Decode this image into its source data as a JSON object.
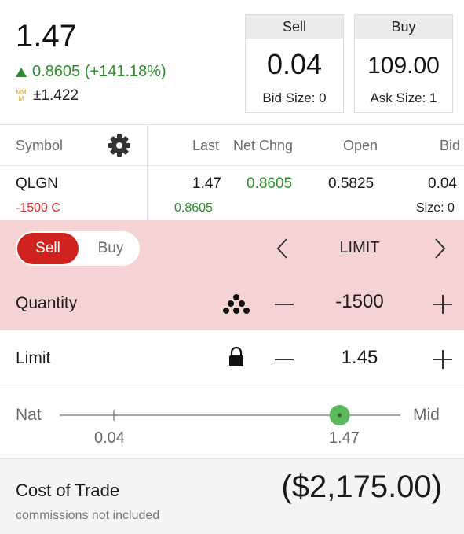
{
  "quote": {
    "last": "1.47",
    "change": "0.8605 (+141.18%)",
    "mm_badge_top": "MM",
    "mm_badge_bottom": "M",
    "mm_value": "±1.422",
    "change_color": "#2e8b2e"
  },
  "sell_box": {
    "header": "Sell",
    "price": "0.04",
    "size_label": "Bid Size: 0"
  },
  "buy_box": {
    "header": "Buy",
    "price": "109.00",
    "size_label": "Ask Size: 1"
  },
  "table": {
    "headers": [
      "Symbol",
      "Last",
      "Net Chng",
      "Open",
      "Bid"
    ],
    "row": {
      "symbol": "QLGN",
      "position": "-1500 C",
      "last": "1.47",
      "net_chng": "0.8605",
      "open": "0.5825",
      "bid": "0.04",
      "sub_net": "0.8605",
      "bid_size": "Size: 0"
    }
  },
  "order": {
    "side_sell": "Sell",
    "side_buy": "Buy",
    "selected_side": "Sell",
    "type": "LIMIT",
    "quantity_label": "Quantity",
    "quantity_value": "-1500",
    "limit_label": "Limit",
    "limit_value": "1.45"
  },
  "slider": {
    "left_label": "Nat",
    "right_label": "Mid",
    "tick_nat": "0.04",
    "tick_mid": "1.47",
    "position_fraction": 0.985
  },
  "cost": {
    "label": "Cost of Trade",
    "note": "commissions not included",
    "value": "($2,175.00)"
  },
  "colors": {
    "accent_red": "#d0231f",
    "green": "#2e8b2e",
    "pink_row": "#f6d3d3",
    "slider_knob": "#5cb85c"
  }
}
